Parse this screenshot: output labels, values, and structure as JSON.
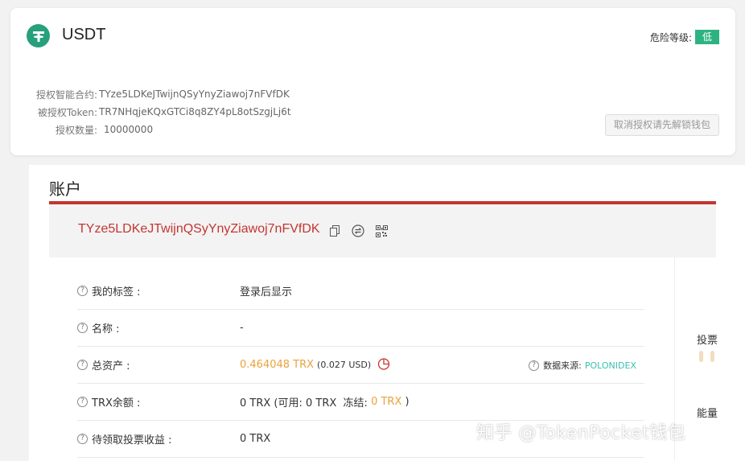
{
  "auth_card": {
    "token_name": "USDT",
    "risk_label": "危险等级:",
    "risk_level": "低",
    "contract_label": "授权智能合约:",
    "contract_value": "TYze5LDKeJTwijnQSyYnyZiawoj7nFVfDK",
    "token_label": "被授权Token:",
    "token_value": "TR7NHqjeKQxGTCi8q8ZY4pL8otSzgjLj6t",
    "qty_label": "授权数量:",
    "qty_value": "10000000",
    "revoke_button": "取消授权请先解锁钱包"
  },
  "account": {
    "title": "账户",
    "address": "TYze5LDKeJTwijnQSyYnyZiawoj7nFVfDK",
    "rows": [
      {
        "label": "我的标签 :",
        "value": "登录后显示"
      },
      {
        "label": "名称 :",
        "value": "-"
      },
      {
        "label": "总资产 :",
        "value": "0.464048 TRX",
        "sub": "(0.027 USD)",
        "source_label": "数据来源:",
        "source_value": "POLONIDEX"
      },
      {
        "label": "TRX余额 :",
        "value_a": "0 TRX (可用: 0 TRX  冻结: ",
        "value_b": "0 TRX",
        "value_c": " )"
      },
      {
        "label": "待领取投票收益 :",
        "value": "0 TRX"
      }
    ],
    "side_vote": "投票",
    "side_energy": "能量"
  },
  "watermark": "知乎 @TokenPocket钱包",
  "colors": {
    "tether_green": "#26a17b",
    "risk_green": "#2db382",
    "accent_red": "#c23631",
    "orange": "#e9a23b",
    "teal": "#3bbfae"
  }
}
